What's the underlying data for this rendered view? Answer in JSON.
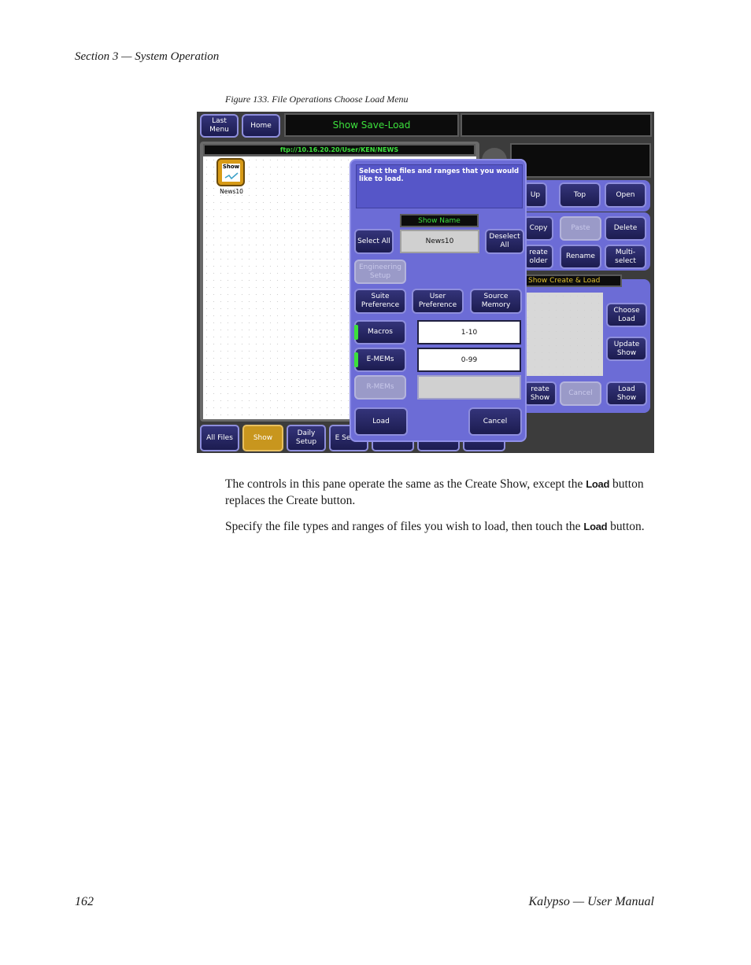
{
  "header": {
    "section": "Section 3 — System Operation"
  },
  "figure": {
    "caption": "Figure 133.  File Operations Choose Load Menu",
    "topbar": {
      "last_menu": "Last Menu",
      "home": "Home",
      "title": "Show Save-Load"
    },
    "path": "ftp://10.16.20.20/User/KEN/NEWS",
    "file_icon": {
      "label": "Show",
      "name": "News10"
    },
    "nav": {
      "up": "Up",
      "top": "Top",
      "open": "Open"
    },
    "file_ops": {
      "copy": "Copy",
      "paste": "Paste",
      "delete": "Delete",
      "create_folder": "reate older",
      "rename": "Rename",
      "multi_select": "Multi- select"
    },
    "show_panel": {
      "title": "Show Create & Load",
      "choose_load": "Choose Load",
      "update_show": "Update Show",
      "create_show": "reate Show",
      "cancel": "Cancel",
      "load_show": "Load Show"
    },
    "dialog": {
      "prompt": "Select the files and ranges that you would like to load.",
      "show_name_label": "Show Name",
      "show_name_value": "News10",
      "select_all": "Select All",
      "deselect_all": "Deselect All",
      "engineering_setup": "Engineering Setup",
      "suite_preference": "Suite Preference",
      "user_preference": "User Preference",
      "source_memory": "Source Memory",
      "macros": "Macros",
      "macros_range": "1-10",
      "emems": "E-MEMs",
      "emems_range": "0-99",
      "rmems": "R-MEMs",
      "load": "Load",
      "cancel": "Cancel"
    },
    "tabs": {
      "all_files": "All Files",
      "show": "Show",
      "daily_setup": "Daily Setup",
      "eng_setup_partial": "E Setup",
      "t4": "",
      "t5": "",
      "t6": ""
    },
    "colors": {
      "panel": "#6c6cd6",
      "button": "#1c1c50",
      "accent_green": "#3ce03c",
      "selected_tab": "#c8961e"
    }
  },
  "paragraphs": {
    "p1_a": "The controls in this pane operate the same as the Create Show, except the",
    "p1_kw": "Load",
    "p1_b": "button replaces the Create button.",
    "p2_a": "Specify the file types and ranges of files you wish to load, then touch the",
    "p2_kw": "Load",
    "p2_b": "button."
  },
  "footer": {
    "page_number": "162",
    "manual": "Kalypso — User Manual"
  }
}
